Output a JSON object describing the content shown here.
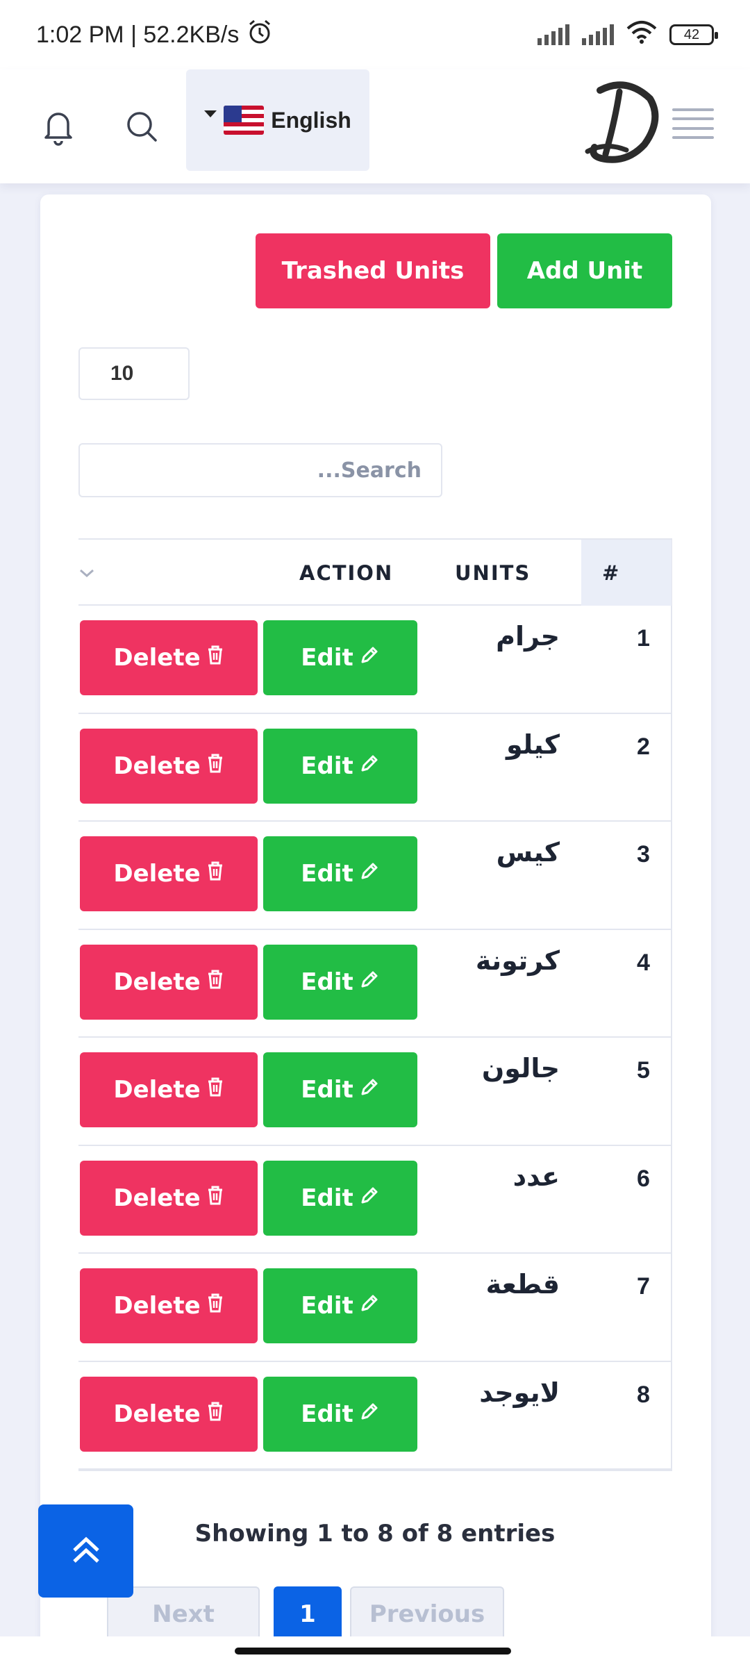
{
  "status_bar": {
    "time": "1:02 PM | 52.2KB/s",
    "battery": "42"
  },
  "header": {
    "language": "English"
  },
  "actions": {
    "trashed_label": "Trashed Units",
    "add_label": "Add Unit"
  },
  "table_controls": {
    "page_length": "10",
    "search_placeholder": "...Search"
  },
  "table": {
    "columns": [
      "#",
      "UNITS",
      "ACTION"
    ],
    "rows": [
      {
        "num": "1",
        "unit": "جرام"
      },
      {
        "num": "2",
        "unit": "كيلو"
      },
      {
        "num": "3",
        "unit": "كيس"
      },
      {
        "num": "4",
        "unit": "كرتونة"
      },
      {
        "num": "5",
        "unit": "جالون"
      },
      {
        "num": "6",
        "unit": "عدد"
      },
      {
        "num": "7",
        "unit": "قطعة"
      },
      {
        "num": "8",
        "unit": "لايوجد"
      }
    ],
    "delete_label": "Delete",
    "edit_label": "Edit"
  },
  "pagination": {
    "info": "Showing 1 to 8 of 8 entries",
    "next": "Next",
    "current": "1",
    "previous": "Previous"
  },
  "colors": {
    "danger": "#ef3361",
    "success": "#22bd45",
    "primary": "#0b63e5"
  },
  "icons": [
    "bell-icon",
    "search-icon",
    "caret-down-icon",
    "us-flag-icon",
    "logo",
    "menu-icon",
    "trash-icon",
    "pencil-icon",
    "chevron-down-icon",
    "double-chevron-up-icon",
    "alarm-icon",
    "signal-icon",
    "wifi-icon",
    "battery-icon"
  ]
}
